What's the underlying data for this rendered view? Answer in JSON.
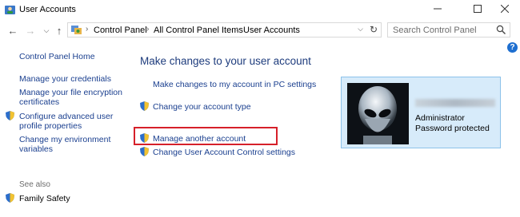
{
  "window": {
    "title": "User Accounts"
  },
  "address": {
    "crumbs": [
      "Control Panel",
      "All Control Panel Items",
      "User Accounts"
    ]
  },
  "search": {
    "placeholder": "Search Control Panel"
  },
  "left": {
    "home": "Control Panel Home",
    "links": [
      "Manage your credentials",
      "Manage your file encryption certificates",
      "Configure advanced user profile properties",
      "Change my environment variables"
    ],
    "see_also": "See also",
    "family_safety": "Family Safety"
  },
  "main": {
    "heading": "Make changes to your user account",
    "links": {
      "pc_settings": "Make changes to my account in PC settings",
      "account_type": "Change your account type",
      "manage_other": "Manage another account",
      "uac": "Change User Account Control settings"
    }
  },
  "account": {
    "role": "Administrator",
    "status": "Password protected"
  },
  "colors": {
    "link": "#1a3f8f",
    "heading": "#1e3c7d",
    "card_bg": "#d7ebfa",
    "card_border": "#8cc2ea",
    "highlight": "#d6202a"
  }
}
